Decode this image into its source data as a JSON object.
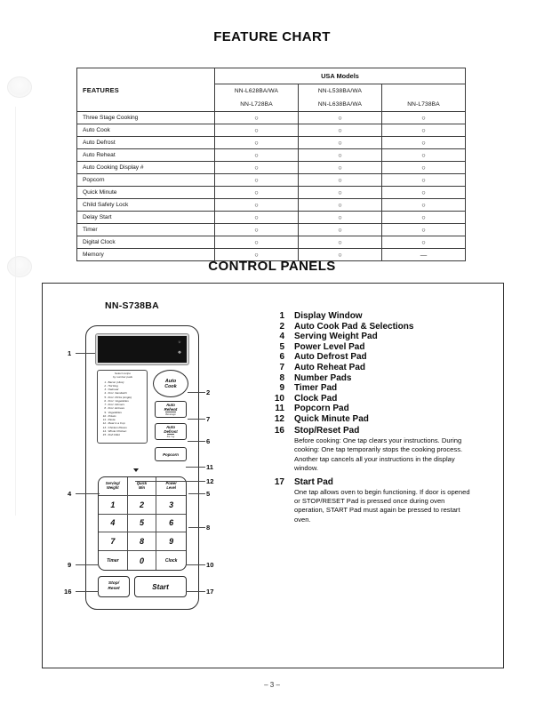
{
  "headings": {
    "feature_chart": "FEATURE CHART",
    "control_panels": "CONTROL PANELS"
  },
  "feature_table": {
    "header_features": "FEATURES",
    "header_group": "USA Models",
    "model_columns": [
      {
        "line1": "NN-L628BA/WA",
        "line2": "NN-L728BA"
      },
      {
        "line1": "NN-L538BA/WA",
        "line2": "NN-L638BA/WA"
      },
      {
        "line1": "",
        "line2": "NN-L738BA"
      }
    ],
    "mark_yes": "○",
    "mark_no": "—",
    "rows": [
      {
        "feature": "Three Stage Cooking",
        "values": [
          "○",
          "○",
          "○"
        ]
      },
      {
        "feature": "Auto Cook",
        "values": [
          "○",
          "○",
          "○"
        ]
      },
      {
        "feature": "Auto Defrost",
        "values": [
          "○",
          "○",
          "○"
        ]
      },
      {
        "feature": "Auto Reheat",
        "values": [
          "○",
          "○",
          "○"
        ]
      },
      {
        "feature": "Auto Cooking Display #",
        "values": [
          "○",
          "○",
          "○"
        ]
      },
      {
        "feature": "Popcorn",
        "values": [
          "○",
          "○",
          "○"
        ]
      },
      {
        "feature": "Quick Minute",
        "values": [
          "○",
          "○",
          "○"
        ]
      },
      {
        "feature": "Child Safety Lock",
        "values": [
          "○",
          "○",
          "○"
        ]
      },
      {
        "feature": "Delay Start",
        "values": [
          "○",
          "○",
          "○"
        ]
      },
      {
        "feature": "Timer",
        "values": [
          "○",
          "○",
          "○"
        ]
      },
      {
        "feature": "Digital Clock",
        "values": [
          "○",
          "○",
          "○"
        ]
      },
      {
        "feature": "Memory",
        "values": [
          "○",
          "○",
          "—"
        ]
      }
    ]
  },
  "control_panel": {
    "model_label": "NN-S738BA",
    "legend": [
      {
        "num": "1",
        "label": "Display Window"
      },
      {
        "num": "2",
        "label": "Auto Cook Pad & Selections"
      },
      {
        "num": "4",
        "label": "Serving Weight Pad"
      },
      {
        "num": "5",
        "label": "Power Level Pad"
      },
      {
        "num": "6",
        "label": "Auto Defrost Pad"
      },
      {
        "num": "7",
        "label": "Auto Reheat Pad"
      },
      {
        "num": "8",
        "label": "Number Pads"
      },
      {
        "num": "9",
        "label": "Timer Pad"
      },
      {
        "num": "10",
        "label": "Clock Pad"
      },
      {
        "num": "11",
        "label": "Popcorn Pad"
      },
      {
        "num": "12",
        "label": "Quick Minute Pad"
      },
      {
        "num": "16",
        "label": "Stop/Reset Pad",
        "description": "Before cooking: One tap clears your instructions. During cooking: One tap temporarily stops the cooking process. Another tap cancels all your instructions in the display window."
      },
      {
        "num": "17",
        "label": "Start Pad",
        "description": "One tap allows oven to begin functioning. If door is opened or STOP/RESET Pad is pressed once during oven operation, START Pad must again be pressed to restart oven."
      }
    ],
    "recipe_menu": {
      "heading_line1": "Select recipe",
      "heading_line2": "by number pads",
      "items": [
        {
          "n": "1.",
          "name": "Bacon (slice)"
        },
        {
          "n": "2.",
          "name": "Hot Dog"
        },
        {
          "n": "3.",
          "name": "Oatmeal"
        },
        {
          "n": "4.",
          "name": "Froz. Sandwich"
        },
        {
          "n": "5.",
          "name": "Froz. Pizza (single)"
        },
        {
          "n": "6.",
          "name": "Froz. Vegetables"
        },
        {
          "n": "7.",
          "name": "Froz. Dinners"
        },
        {
          "n": "8.",
          "name": "Froz. Entrees"
        },
        {
          "n": "9.",
          "name": "Vegetables"
        },
        {
          "n": "10.",
          "name": "Potato"
        },
        {
          "n": "11.",
          "name": "Pasta"
        },
        {
          "n": "12.",
          "name": "Meal in a Cup"
        },
        {
          "n": "13.",
          "name": "Chicken Pieces"
        },
        {
          "n": "14.",
          "name": "Whole Chicken"
        },
        {
          "n": "15.",
          "name": "Fish Fillet"
        }
      ]
    },
    "pads": {
      "auto_cook_line1": "Auto",
      "auto_cook_line2": "Cook",
      "auto_reheat_line1": "Auto",
      "auto_reheat_line2": "Reheat",
      "auto_reheat_sub": "Beverage",
      "auto_defrost_line1": "Auto",
      "auto_defrost_line2": "Defrost",
      "auto_defrost_sub": "lbs / kg",
      "popcorn": "Popcorn",
      "serving_weight_line1": "Serving/",
      "serving_weight_line2": "Weight",
      "quick_min_line1": "Quick",
      "quick_min_line2": "Min",
      "power_level_line1": "Power",
      "power_level_line2": "Level",
      "number_keys": [
        "1",
        "2",
        "3",
        "4",
        "5",
        "6",
        "7",
        "8",
        "9"
      ],
      "timer": "Timer",
      "zero": "0",
      "clock": "Clock",
      "stop_reset_line1": "Stop/",
      "stop_reset_line2": "Reset",
      "start": "Start"
    },
    "callouts_left": [
      "1",
      "4",
      "9",
      "16"
    ],
    "callouts_right": [
      "2",
      "7",
      "6",
      "11",
      "12",
      "5",
      "8",
      "10",
      "17"
    ]
  },
  "footer": {
    "page": "– 3 –"
  }
}
